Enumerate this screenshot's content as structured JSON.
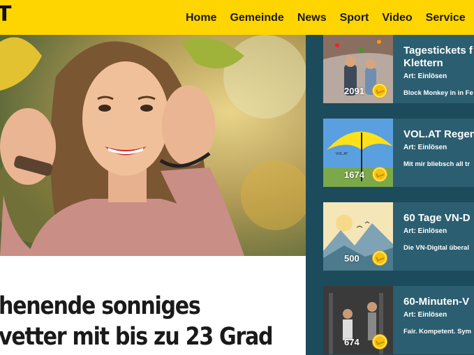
{
  "header": {
    "logo": "T",
    "nav": [
      "Home",
      "Gemeinde",
      "News",
      "Sport",
      "Video",
      "Service"
    ]
  },
  "article": {
    "headline_line1": "henende sonniges",
    "headline_line2": "vetter mit bis zu 23 Grad"
  },
  "cards": [
    {
      "title": "Tagestickets f",
      "title2": "Klettern",
      "type": "Art: Einlösen",
      "desc": "Block Monkey in in Fe",
      "points": "2091"
    },
    {
      "title": "VOL.AT Regen",
      "title2": "",
      "type": "Art: Einlösen",
      "desc": "Mit mir bliebsch all tr",
      "points": "1674"
    },
    {
      "title": "60 Tage VN-D",
      "title2": "",
      "type": "Art: Einlösen",
      "desc": "Die VN-Digital überal",
      "points": "500"
    },
    {
      "title": "60-Minuten-V",
      "title2": "",
      "type": "Art: Einlösen",
      "desc": "Fair. Kompetent. Sym",
      "points": "674"
    }
  ]
}
